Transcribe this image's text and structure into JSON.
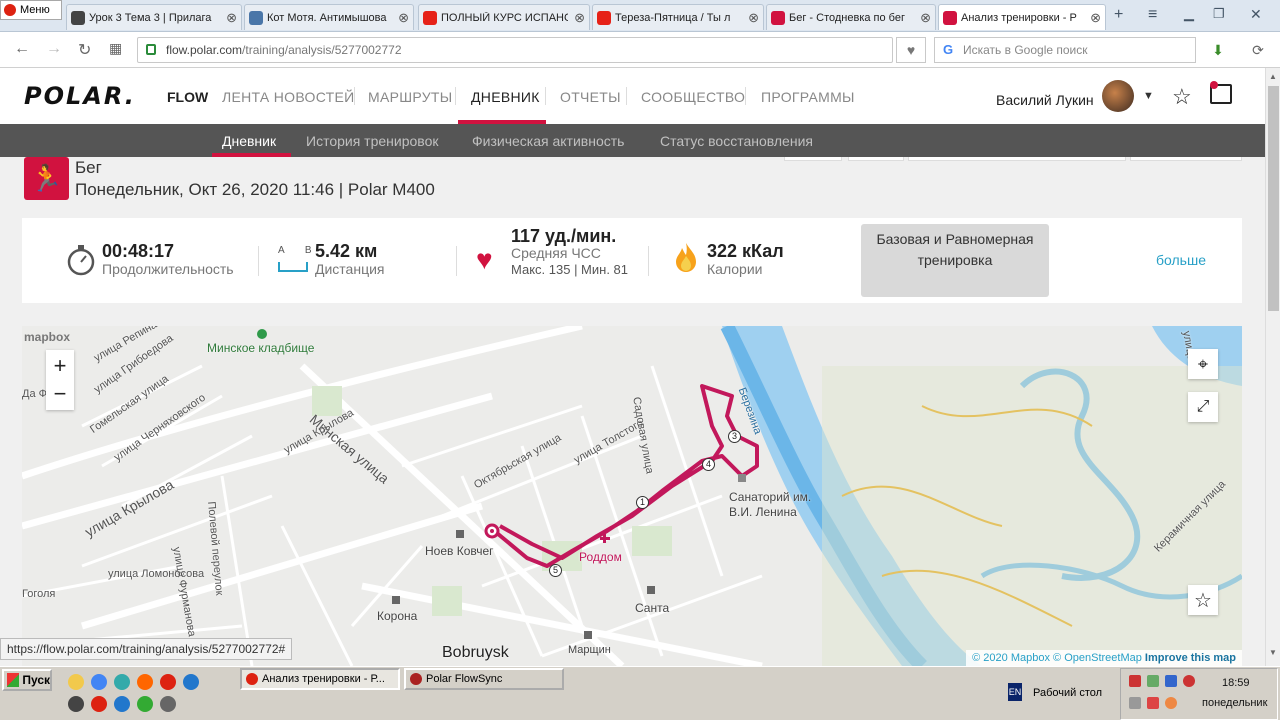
{
  "browser": {
    "menu_label": "Меню",
    "tabs": [
      {
        "title": "Урок 3 Тема 3 | Прилага",
        "icon": "document-icon",
        "color": "#444444"
      },
      {
        "title": "Кот Мотя. Антимышова",
        "icon": "vk-icon",
        "color": "#4a76a8"
      },
      {
        "title": "ПОЛНЫЙ КУРС ИСПАНС",
        "icon": "youtube-icon",
        "color": "#e62117"
      },
      {
        "title": "Тереза-Пятница / Ты л",
        "icon": "youtube-icon",
        "color": "#e62117"
      },
      {
        "title": "Бег - Стодневка по бег",
        "icon": "no-entry-icon",
        "color": "#d1123f"
      },
      {
        "title": "Анализ тренировки - Р",
        "icon": "polar-icon",
        "color": "#d1123f"
      }
    ],
    "active_tab": 5,
    "url_host": "flow.polar.com",
    "url_path": "/training/analysis/5277002772",
    "search_placeholder": "Искать в Google поиск",
    "status_url": "https://flow.polar.com/training/analysis/5277002772#"
  },
  "header": {
    "logo": "POLAR.",
    "product": "FLOW",
    "nav": [
      "ЛЕНТА НОВОСТЕЙ",
      "МАРШРУТЫ",
      "ДНЕВНИК",
      "ОТЧЕТЫ",
      "СООБЩЕСТВО",
      "ПРОГРАММЫ"
    ],
    "active_nav": "ДНЕВНИК",
    "user_name": "Василий Лукин",
    "accent": "#d1123f"
  },
  "subnav": {
    "items": [
      "Дневник",
      "История тренировок",
      "Физическая активность",
      "Статус восстановления"
    ],
    "active": "Дневник"
  },
  "session": {
    "sport": "Бег",
    "datetime_device": "Понедельник, Окт 26, 2020 11:46 | Polar M400"
  },
  "summary": {
    "duration_value": "00:48:17",
    "duration_label": "Продолжительность",
    "distance_ab": "A B",
    "distance_value": "5.42 км",
    "distance_label": "Дистанция",
    "hr_value": "117 уд./мин.",
    "hr_label": "Средняя ЧСС",
    "hr_minmax": "Макс. 135 | Мин. 81",
    "calories_value": "322 кКал",
    "calories_label": "Калории",
    "training_type": "Базовая и Равномерная тренировка",
    "more": "больше"
  },
  "map": {
    "provider_logo": "mapbox",
    "attribution_1": "© 2020 Mapbox",
    "attribution_2": "© OpenStreetMap",
    "attribution_3": "Improve this map",
    "labels": [
      "Минское кладбище",
      "улица Репина",
      "улица Грибоедова",
      "Гомельская улица",
      "улица Черняховского",
      "улица Крылова",
      "Минская улица",
      "Октябрьская улица",
      "улица Толстого",
      "Садовая улица",
      "Полевой переулок",
      "улица Фурманова",
      "улица Ломоносова",
      "улица Крылова",
      "Ноев Ковчег",
      "Роддом",
      "Санаторий им. В.И. Ленина",
      "Санта",
      "Корона",
      "Bobruysk",
      "Березина",
      "Керамичная улица",
      "Гоголя",
      "Марщин",
      "улица",
      "Да Фас"
    ],
    "km_markers": [
      "1",
      "3",
      "4",
      "5"
    ],
    "route_color": "#c2185b",
    "river_color": "#6bb6e8"
  },
  "taskbar": {
    "start_label": "Пуск",
    "windows": [
      "Анализ тренировки - Р...",
      "Polar FlowSync"
    ],
    "language": "EN",
    "desktop_label": "Рабочий стол",
    "time": "18:59",
    "day": "понедельник"
  }
}
